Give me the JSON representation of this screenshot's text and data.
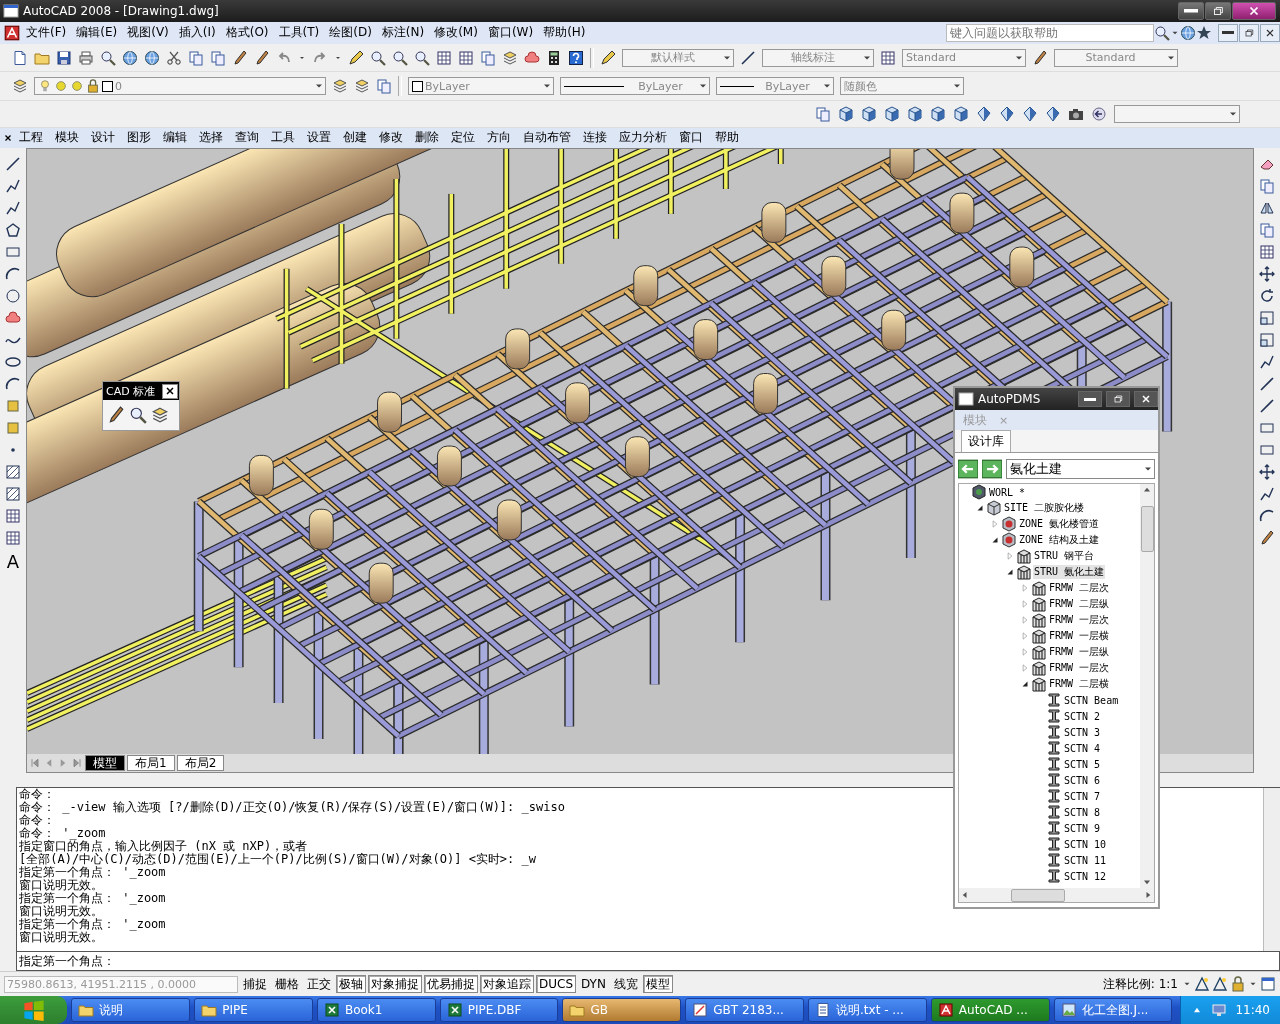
{
  "window": {
    "title": "AutoCAD 2008 - [Drawing1.dwg]"
  },
  "menu_bar": {
    "items": [
      "文件(F)",
      "编辑(E)",
      "视图(V)",
      "插入(I)",
      "格式(O)",
      "工具(T)",
      "绘图(D)",
      "标注(N)",
      "修改(M)",
      "窗口(W)",
      "帮助(H)"
    ],
    "help_search": {
      "placeholder": "键入问题以获取帮助"
    }
  },
  "toolbars": {
    "text_style": "默认样式",
    "dim_style": "轴线标注",
    "table_style": "Standard",
    "multileader_style": "Standard",
    "layer": "0",
    "color_setting": "ByLayer",
    "linetype": "ByLayer",
    "lineweight": "ByLayer",
    "plot_style": "随颜色"
  },
  "pdms_menu": {
    "items": [
      "工程",
      "模块",
      "设计",
      "图形",
      "编辑",
      "选择",
      "查询",
      "工具",
      "设置",
      "创建",
      "修改",
      "删除",
      "定位",
      "方向",
      "自动布管",
      "连接",
      "应力分析",
      "窗口",
      "帮助"
    ]
  },
  "draw_toolbar": {
    "text_tool": "A"
  },
  "cad_standards": {
    "title": "CAD 标准"
  },
  "layout_tabs": [
    {
      "label": "模型",
      "selected": true
    },
    {
      "label": "布局1",
      "selected": false
    },
    {
      "label": "布局2",
      "selected": false
    }
  ],
  "pdms_panel": {
    "title": "AutoPDMS",
    "module_tab": {
      "label": "模块",
      "close": "×"
    },
    "tabs": [
      {
        "label": "设计库",
        "selected": true
      }
    ],
    "database": "氨化土建",
    "tree": [
      {
        "kind": "world",
        "type": "WORL",
        "name": "*",
        "selected": false,
        "children": [
          {
            "kind": "site",
            "type": "SITE",
            "name": "二胺胺化楼",
            "selected": false,
            "expanded": true,
            "children": [
              {
                "kind": "zone",
                "type": "ZONE",
                "name": "氨化楼管道",
                "selected": false,
                "expanded": false
              },
              {
                "kind": "zone",
                "type": "ZONE",
                "name": "结构及土建",
                "selected": false,
                "expanded": true,
                "children": [
                  {
                    "kind": "stru",
                    "type": "STRU",
                    "name": "钢平台",
                    "selected": false,
                    "expanded": false
                  },
                  {
                    "kind": "stru",
                    "type": "STRU",
                    "name": "氨化土建",
                    "selected": true,
                    "expanded": true,
                    "children": [
                      {
                        "kind": "frmw",
                        "type": "FRMW",
                        "name": "二层次",
                        "selected": false,
                        "expanded": false
                      },
                      {
                        "kind": "frmw",
                        "type": "FRMW",
                        "name": "二层纵",
                        "selected": false,
                        "expanded": false
                      },
                      {
                        "kind": "frmw",
                        "type": "FRMW",
                        "name": "一层次",
                        "selected": false,
                        "expanded": false
                      },
                      {
                        "kind": "frmw",
                        "type": "FRMW",
                        "name": "一层横",
                        "selected": false,
                        "expanded": false
                      },
                      {
                        "kind": "frmw",
                        "type": "FRMW",
                        "name": "一层纵",
                        "selected": false,
                        "expanded": false
                      },
                      {
                        "kind": "frmw",
                        "type": "FRMW",
                        "name": "一层次",
                        "selected": false,
                        "expanded": false
                      },
                      {
                        "kind": "frmw",
                        "type": "FRMW",
                        "name": "二层横",
                        "selected": false,
                        "expanded": true,
                        "children": [
                          {
                            "kind": "sctn",
                            "type": "SCTN",
                            "name": "Beam",
                            "selected": false
                          },
                          {
                            "kind": "sctn",
                            "type": "SCTN",
                            "name": "2",
                            "selected": false
                          },
                          {
                            "kind": "sctn",
                            "type": "SCTN",
                            "name": "3",
                            "selected": false
                          },
                          {
                            "kind": "sctn",
                            "type": "SCTN",
                            "name": "4",
                            "selected": false
                          },
                          {
                            "kind": "sctn",
                            "type": "SCTN",
                            "name": "5",
                            "selected": false
                          },
                          {
                            "kind": "sctn",
                            "type": "SCTN",
                            "name": "6",
                            "selected": false
                          },
                          {
                            "kind": "sctn",
                            "type": "SCTN",
                            "name": "7",
                            "selected": false
                          },
                          {
                            "kind": "sctn",
                            "type": "SCTN",
                            "name": "8",
                            "selected": false
                          },
                          {
                            "kind": "sctn",
                            "type": "SCTN",
                            "name": "9",
                            "selected": false
                          },
                          {
                            "kind": "sctn",
                            "type": "SCTN",
                            "name": "10",
                            "selected": false
                          },
                          {
                            "kind": "sctn",
                            "type": "SCTN",
                            "name": "11",
                            "selected": false
                          },
                          {
                            "kind": "sctn",
                            "type": "SCTN",
                            "name": "12",
                            "selected": false
                          }
                        ]
                      }
                    ]
                  }
                ]
              }
            ]
          }
        ]
      }
    ]
  },
  "command_window": {
    "history": [
      "命令：",
      "命令： _-view 输入选项 [?/删除(D)/正交(O)/恢复(R)/保存(S)/设置(E)/窗口(W)]: _swiso",
      "命令：",
      "命令： '_zoom",
      "指定窗口的角点，输入比例因子 (nX 或 nXP)，或者",
      "[全部(A)/中心(C)/动态(D)/范围(E)/上一个(P)/比例(S)/窗口(W)/对象(O)] <实时>: _w",
      "指定第一个角点： '_zoom",
      "窗口说明无效。",
      "指定第一个角点： '_zoom",
      "窗口说明无效。",
      "指定第一个角点： '_zoom",
      "窗口说明无效。"
    ],
    "prompt": "指定第一个角点："
  },
  "status_bar": {
    "coordinates": "75980.8613, 41951.2115 , 0.0000",
    "toggles": [
      {
        "label": "捕捉",
        "on": false
      },
      {
        "label": "栅格",
        "on": false
      },
      {
        "label": "正交",
        "on": false
      },
      {
        "label": "极轴",
        "on": true
      },
      {
        "label": "对象捕捉",
        "on": true
      },
      {
        "label": "优易捕捉",
        "on": true
      },
      {
        "label": "对象追踪",
        "on": true
      },
      {
        "label": "DUCS",
        "on": true
      },
      {
        "label": "DYN",
        "on": false
      },
      {
        "label": "线宽",
        "on": false
      },
      {
        "label": "模型",
        "on": true
      }
    ],
    "annotation_scale_label": "注释比例:",
    "annotation_scale": "1:1"
  },
  "taskbar": {
    "items": [
      {
        "label": "说明",
        "kind": "folder",
        "selected": false,
        "flashing": false
      },
      {
        "label": "PIPE",
        "kind": "folder",
        "selected": false,
        "flashing": false
      },
      {
        "label": "Book1",
        "kind": "spreadsheet",
        "selected": false,
        "flashing": false
      },
      {
        "label": "PIPE.DBF",
        "kind": "spreadsheet",
        "selected": false,
        "flashing": false
      },
      {
        "label": "GB",
        "kind": "folder",
        "selected": false,
        "flashing": true
      },
      {
        "label": "GBT 2183...",
        "kind": "document",
        "selected": false,
        "flashing": false
      },
      {
        "label": "说明.txt - ...",
        "kind": "notepad",
        "selected": false,
        "flashing": false
      },
      {
        "label": "AutoCAD ...",
        "kind": "cad",
        "selected": true,
        "flashing": false
      },
      {
        "label": "化工全图.J...",
        "kind": "picture",
        "selected": false,
        "flashing": false
      }
    ],
    "clock": "11:40"
  }
}
